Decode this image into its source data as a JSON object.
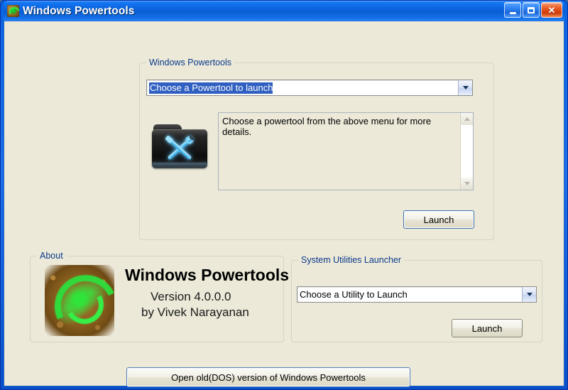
{
  "window": {
    "title": "Windows Powertools",
    "icon": "app-spiral-icon",
    "minimize_label": "Minimize",
    "maximize_label": "Maximize",
    "close_label": "✕"
  },
  "powertools_group": {
    "legend": "Windows Powertools",
    "combo": {
      "value": "Choose a Powertool to launch",
      "selected": true
    },
    "icon_name": "tools-folder-icon",
    "details_text": "Choose a powertool from the above menu for more details.",
    "launch_label": "Launch"
  },
  "about_group": {
    "legend": "About",
    "logo_name": "green-spiral-logo",
    "title": "Windows Powertools",
    "version": "Version 4.0.0.0",
    "author": "by Vivek Narayanan"
  },
  "utilities_group": {
    "legend": "System Utilities Launcher",
    "combo": {
      "value": "Choose a Utility to Launch",
      "selected": false
    },
    "launch_label": "Launch"
  },
  "footer": {
    "dos_button_label": "Open old(DOS) version of Windows Powertools"
  },
  "colors": {
    "client_bg": "#ece9d8",
    "titlebar_blue": "#0b63dc",
    "legend_text": "#0b3a8c",
    "selection_blue": "#2f5fc0",
    "close_red": "#ea5b22"
  }
}
